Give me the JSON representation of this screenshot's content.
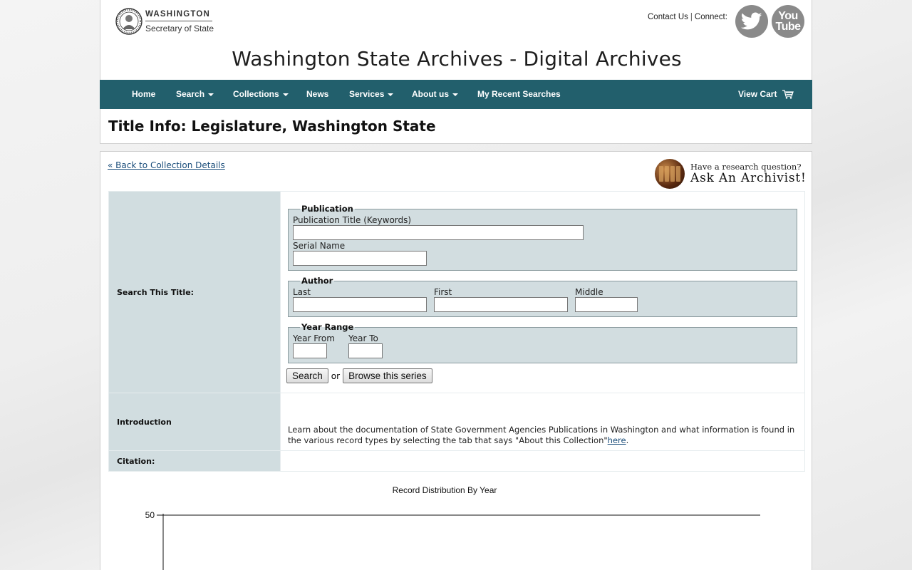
{
  "header": {
    "logo_top": "WASHINGTON",
    "logo_sub": "Secretary of State",
    "contact": "Contact Us",
    "separator": "|",
    "connect": "Connect:",
    "youtube_line1": "You",
    "youtube_line2": "Tube",
    "site_title": "Washington State Archives - Digital Archives"
  },
  "nav": {
    "items": [
      {
        "label": "Home",
        "dropdown": false
      },
      {
        "label": "Search",
        "dropdown": true
      },
      {
        "label": "Collections",
        "dropdown": true
      },
      {
        "label": "News",
        "dropdown": false
      },
      {
        "label": "Services",
        "dropdown": true
      },
      {
        "label": "About us",
        "dropdown": true
      },
      {
        "label": "My Recent Searches",
        "dropdown": false
      }
    ],
    "cart": "View Cart"
  },
  "page_title": "Title Info: Legislature, Washington State",
  "back_link": "« Back to Collection Details",
  "ask": {
    "question": "Have a research question?",
    "title": "Ask An Archivist!"
  },
  "search": {
    "label": "Search This Title:",
    "publication": {
      "legend": "Publication",
      "title_label": "Publication Title (Keywords)",
      "title_value": "",
      "serial_label": "Serial Name",
      "serial_value": ""
    },
    "author": {
      "legend": "Author",
      "last_label": "Last",
      "first_label": "First",
      "middle_label": "Middle"
    },
    "year": {
      "legend": "Year Range",
      "from_label": "Year From",
      "to_label": "Year To"
    },
    "search_button": "Search",
    "or": "or",
    "browse_button": "Browse this series"
  },
  "introduction": {
    "label": "Introduction",
    "text": "Learn about the documentation of State Government Agencies Publications in Washington and what information is found in the various record types by selecting the tab that says \"About this Collection\"",
    "link": "here",
    "after": "."
  },
  "citation": {
    "label": "Citation:",
    "value": ""
  },
  "colors": {
    "nav_bg": "#225f6c",
    "label_bg": "#d1dde0",
    "link": "#1a4d7a"
  },
  "chart_data": {
    "type": "bar",
    "title": "Record Distribution By Year",
    "yticks": [
      "50"
    ],
    "ylim": [
      0,
      50
    ],
    "categories": [],
    "values": []
  }
}
